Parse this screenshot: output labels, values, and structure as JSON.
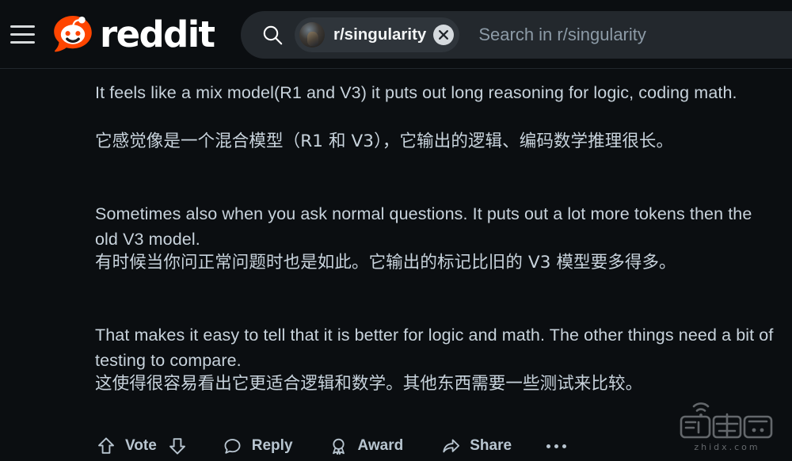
{
  "header": {
    "menu_icon": "hamburger-menu-icon",
    "logo_icon": "reddit-snoo-icon",
    "wordmark": "reddit",
    "search": {
      "icon": "search-icon",
      "subreddit_chip": "r/singularity",
      "chip_avatar_icon": "subreddit-avatar-icon",
      "clear_icon": "close-icon",
      "placeholder": "Search in r/singularity",
      "value": ""
    }
  },
  "comment": {
    "paragraphs": [
      {
        "lang": "en",
        "text": "It feels like a mix model(R1 and V3) it puts out long reasoning for logic, coding math."
      },
      {
        "lang": "zh",
        "text": "它感觉像是一个混合模型（R1 和 V3），它输出的逻辑、编码数学推理很长。"
      },
      {
        "lang": "en",
        "text": "Sometimes also when you ask normal questions. It puts out a lot more tokens then the old V3 model."
      },
      {
        "lang": "zh",
        "text": "有时候当你问正常问题时也是如此。它输出的标记比旧的 V3 模型要多得多。"
      },
      {
        "lang": "en",
        "text": "That makes it easy to tell that it is better for logic and math. The other things need a bit of testing to compare."
      },
      {
        "lang": "zh",
        "text": "这使得很容易看出它更适合逻辑和数学。其他东西需要一些测试来比较。"
      }
    ]
  },
  "actions": {
    "upvote_icon": "upvote-arrow-icon",
    "vote_label": "Vote",
    "downvote_icon": "downvote-arrow-icon",
    "reply_icon": "comment-bubble-icon",
    "reply_label": "Reply",
    "award_icon": "award-badge-icon",
    "award_label": "Award",
    "share_icon": "share-arrow-icon",
    "share_label": "Share",
    "more_icon": "more-horizontal-icon"
  },
  "watermark": {
    "logo_icon": "zhidx-logo-icon",
    "text": "zhidx.com"
  },
  "colors": {
    "background": "#0b0e11",
    "header_bg": "#0b0e11",
    "search_bg": "#23282d",
    "chip_bg": "#2f353b",
    "brand_orange": "#ff4500",
    "body_text": "#c8d3dc",
    "placeholder": "#8c9aa6",
    "action_text": "#b8c5d0"
  }
}
